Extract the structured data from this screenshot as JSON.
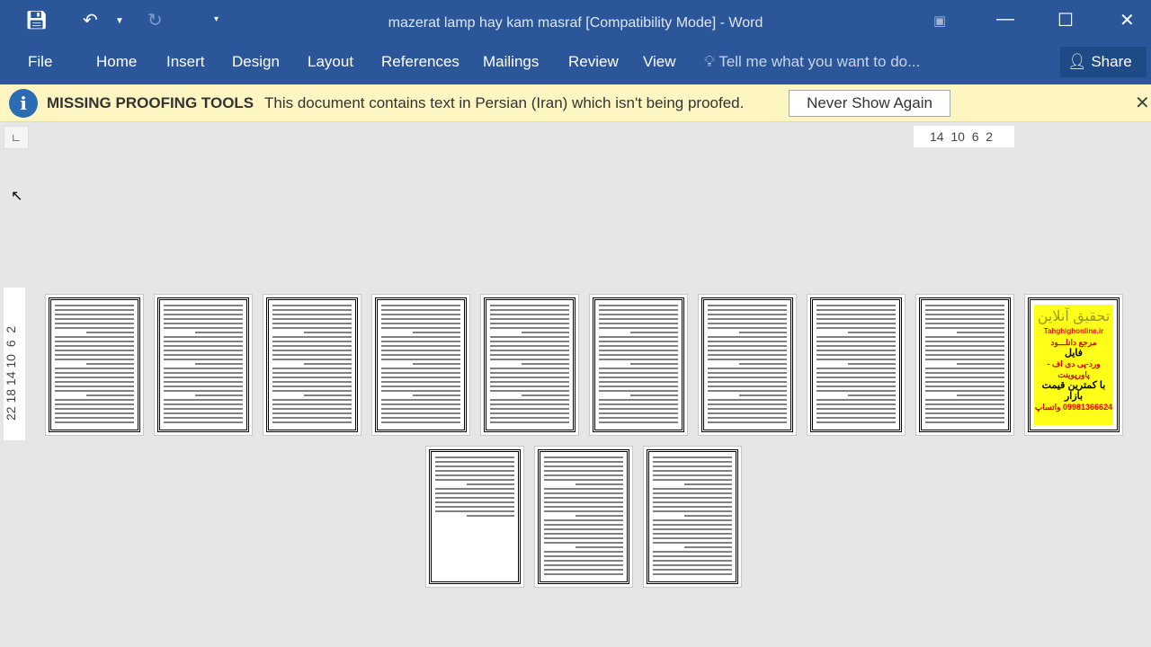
{
  "window": {
    "title": "mazerat lamp hay kam masraf [Compatibility Mode] - Word"
  },
  "ribbon": {
    "tabs": [
      "File",
      "Home",
      "Insert",
      "Design",
      "Layout",
      "References",
      "Mailings",
      "Review",
      "View"
    ],
    "tell_me": "Tell me what you want to do...",
    "share": "Share"
  },
  "message_bar": {
    "title": "MISSING PROOFING TOOLS",
    "text": "This document contains text in Persian (Iran) which isn't being proofed.",
    "button": "Never Show Again"
  },
  "rulers": {
    "horizontal": "14  10  6  2",
    "vertical": "22 18 14 10  6  2"
  },
  "pages": {
    "row1_count": 10,
    "row2_count": 3,
    "row2_first_partial": true,
    "ad": {
      "title": "تحقیق آنلاین",
      "site": "Tahghighonline.ir",
      "l1": "مرجع دانلـــود",
      "l2": "فایل",
      "l3": "ورد-پی دی اف - پاورپوینت",
      "l4": "با کمترین قیمت بازار",
      "l5": "09981366624 واتساپ"
    }
  },
  "colors": {
    "ribbon": "#2b579a",
    "message_bar": "#fdf6c3",
    "ad": "#ffff1a"
  }
}
